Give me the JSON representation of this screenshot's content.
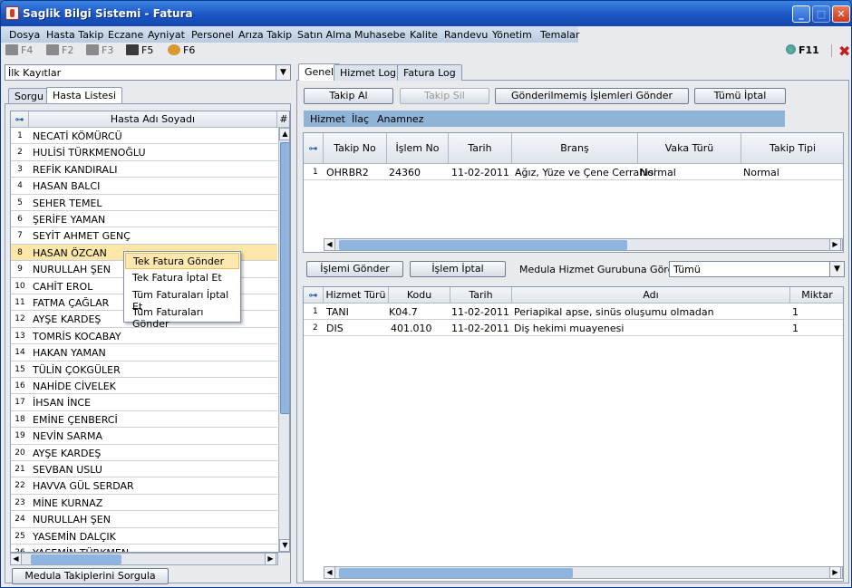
{
  "window": {
    "title": "Saglik Bilgi Sistemi - Fatura"
  },
  "menu": [
    "Dosya",
    "Hasta Takip",
    "Eczane",
    "Ayniyat",
    "Personel",
    "Arıza Takip",
    "Satın Alma",
    "Muhasebe",
    "Kalite",
    "Randevu",
    "Yönetim",
    "Temalar"
  ],
  "toolbar": {
    "f4": "F4",
    "f2": "F2",
    "f3": "F3",
    "f5": "F5",
    "f6": "F6",
    "f11": "F11"
  },
  "left": {
    "combo_value": "İlk Kayıtlar",
    "tabs": [
      "Sorgu",
      "Hasta Listesi"
    ],
    "table_header": "Hasta Adı Soyadı",
    "hash_header": "#",
    "patients": [
      {
        "n": "1",
        "name": "NECATİ KÖMÜRCÜ"
      },
      {
        "n": "2",
        "name": "HULİSİ TÜRKMENOĞLU"
      },
      {
        "n": "3",
        "name": "REFİK KANDIRALI"
      },
      {
        "n": "4",
        "name": "HASAN BALCI"
      },
      {
        "n": "5",
        "name": "SEHER TEMEL"
      },
      {
        "n": "6",
        "name": "ŞERİFE YAMAN"
      },
      {
        "n": "7",
        "name": "SEYİT AHMET GENÇ"
      },
      {
        "n": "8",
        "name": "HASAN ÖZCAN"
      },
      {
        "n": "9",
        "name": "NURULLAH ŞEN"
      },
      {
        "n": "10",
        "name": "CAHİT EROL"
      },
      {
        "n": "11",
        "name": "FATMA ÇAĞLAR"
      },
      {
        "n": "12",
        "name": "AYŞE KARDEŞ"
      },
      {
        "n": "13",
        "name": "TOMRİS KOCABAY"
      },
      {
        "n": "14",
        "name": "HAKAN YAMAN"
      },
      {
        "n": "15",
        "name": "TÜLİN ÇOKGÜLER"
      },
      {
        "n": "16",
        "name": "NAHİDE CİVELEK"
      },
      {
        "n": "17",
        "name": "İHSAN İNCE"
      },
      {
        "n": "18",
        "name": "EMİNE ÇENBERCİ"
      },
      {
        "n": "19",
        "name": "NEVİN SARMA"
      },
      {
        "n": "20",
        "name": "AYŞE KARDEŞ"
      },
      {
        "n": "21",
        "name": "SEVBAN USLU"
      },
      {
        "n": "22",
        "name": "HAVVA GÜL SERDAR"
      },
      {
        "n": "23",
        "name": "MİNE KURNAZ"
      },
      {
        "n": "24",
        "name": "NURULLAH ŞEN"
      },
      {
        "n": "25",
        "name": "YASEMİN DALÇIK"
      },
      {
        "n": "26",
        "name": "YASEMİN TÜRKMEN"
      }
    ],
    "selected_index": 7,
    "bottom_button": "Medula Takiplerini Sorgula"
  },
  "context_menu": [
    "Tek Fatura Gönder",
    "Tek Fatura İptal Et",
    "Tüm Faturaları İptal Et",
    "Tüm Faturaları Gönder"
  ],
  "right": {
    "tabs": [
      "Genel",
      "Hizmet Log",
      "Fatura Log"
    ],
    "buttons": [
      "Takip Al",
      "Takip Sil",
      "Gönderilmemiş İşlemleri Gönder",
      "Tümü İptal"
    ],
    "subtabs": [
      "Hizmet",
      "İlaç",
      "Anamnez"
    ],
    "takip_headers": [
      "Takip No",
      "İşlem No",
      "Tarih",
      "Branş",
      "Vaka Türü",
      "Takip Tipi"
    ],
    "takip_rows": [
      {
        "rn": "1",
        "takip_no": "OHRBR2",
        "islem_no": "24360",
        "tarih": "11-02-2011",
        "brans": "Ağız, Yüze ve Çene Cerrahisi",
        "vaka": "Normal",
        "tip": "Normal"
      }
    ],
    "islem_buttons": [
      "İşlemi Gönder",
      "İşlem İptal"
    ],
    "medula_label": "Medula Hizmet Gurubuna Göre",
    "medula_value": "Tümü",
    "hizmet_headers": [
      "Hizmet Türü",
      "Kodu",
      "Tarih",
      "Adı",
      "Miktar"
    ],
    "hizmet_rows": [
      {
        "rn": "1",
        "tur": "TANI",
        "kodu": "K04.7",
        "tarih": "11-02-2011",
        "adi": "Periapikal apse, sinüs oluşumu olmadan",
        "miktar": "1"
      },
      {
        "rn": "2",
        "tur": "DIS",
        "kodu": "401.010",
        "tarih": "11-02-2011",
        "adi": "Diş hekimi muayenesi",
        "miktar": "1"
      }
    ]
  }
}
